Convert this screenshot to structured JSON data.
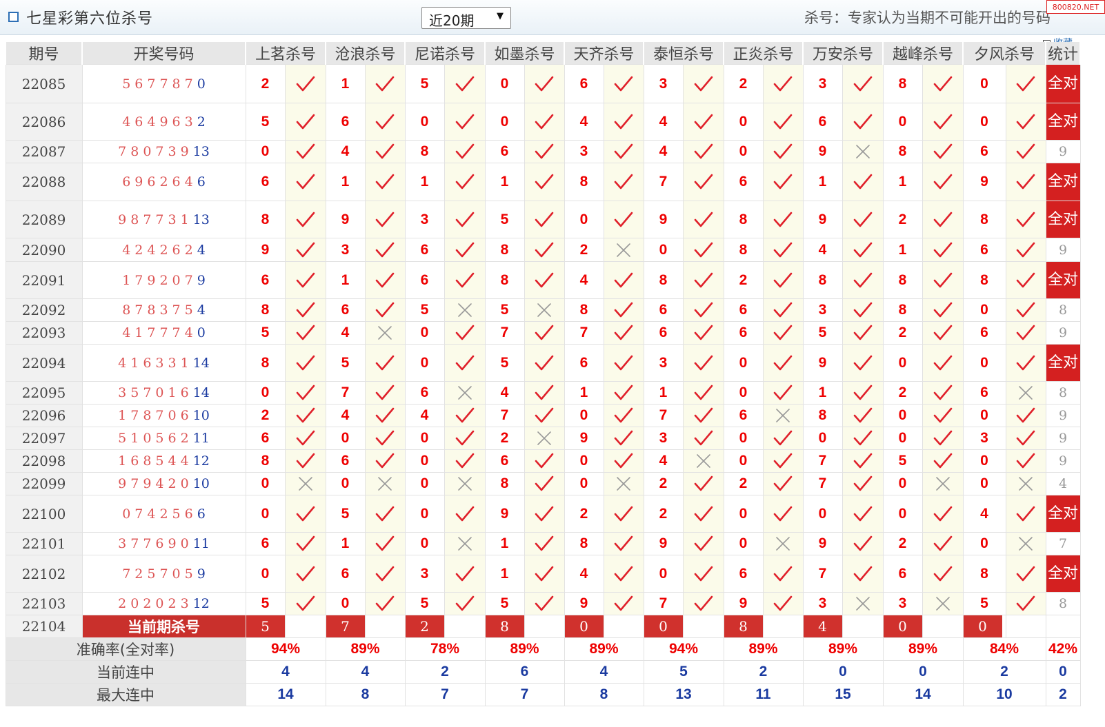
{
  "header": {
    "title": "七星彩第六位杀号",
    "period_select": "近20期",
    "hint": "杀号：专家认为当期不可能开出的号码",
    "watermark": "800820.NET",
    "collect": "收藏"
  },
  "columns": {
    "period": "期号",
    "numbers": "开奖号码",
    "experts": [
      "上茗杀号",
      "沧浪杀号",
      "尼诺杀号",
      "如墨杀号",
      "天齐杀号",
      "泰恒杀号",
      "正炎杀号",
      "万安杀号",
      "越峰杀号",
      "夕风杀号"
    ],
    "stats": "统计"
  },
  "rows": [
    {
      "period": "22085",
      "nums": "567787",
      "last": "0",
      "kills": [
        "2",
        "1",
        "5",
        "0",
        "6",
        "3",
        "2",
        "3",
        "8",
        "0"
      ],
      "hits": [
        1,
        1,
        1,
        1,
        1,
        1,
        1,
        1,
        1,
        1
      ],
      "stat": "全对"
    },
    {
      "period": "22086",
      "nums": "464963",
      "last": "2",
      "kills": [
        "5",
        "6",
        "0",
        "0",
        "4",
        "4",
        "0",
        "6",
        "0",
        "0"
      ],
      "hits": [
        1,
        1,
        1,
        1,
        1,
        1,
        1,
        1,
        1,
        1
      ],
      "stat": "全对"
    },
    {
      "period": "22087",
      "nums": "780739",
      "last": "13",
      "kills": [
        "0",
        "4",
        "8",
        "6",
        "3",
        "4",
        "0",
        "9",
        "8",
        "6"
      ],
      "hits": [
        1,
        1,
        1,
        1,
        1,
        1,
        1,
        0,
        1,
        1
      ],
      "stat": "9"
    },
    {
      "period": "22088",
      "nums": "696264",
      "last": "6",
      "kills": [
        "6",
        "1",
        "1",
        "1",
        "8",
        "7",
        "6",
        "1",
        "1",
        "9"
      ],
      "hits": [
        1,
        1,
        1,
        1,
        1,
        1,
        1,
        1,
        1,
        1
      ],
      "stat": "全对"
    },
    {
      "period": "22089",
      "nums": "987731",
      "last": "13",
      "kills": [
        "8",
        "9",
        "3",
        "5",
        "0",
        "9",
        "8",
        "9",
        "2",
        "8"
      ],
      "hits": [
        1,
        1,
        1,
        1,
        1,
        1,
        1,
        1,
        1,
        1
      ],
      "stat": "全对"
    },
    {
      "period": "22090",
      "nums": "424262",
      "last": "4",
      "kills": [
        "9",
        "3",
        "6",
        "8",
        "2",
        "0",
        "8",
        "4",
        "1",
        "6"
      ],
      "hits": [
        1,
        1,
        1,
        1,
        0,
        1,
        1,
        1,
        1,
        1
      ],
      "stat": "9"
    },
    {
      "period": "22091",
      "nums": "179207",
      "last": "9",
      "kills": [
        "6",
        "1",
        "6",
        "8",
        "4",
        "8",
        "2",
        "8",
        "8",
        "8"
      ],
      "hits": [
        1,
        1,
        1,
        1,
        1,
        1,
        1,
        1,
        1,
        1
      ],
      "stat": "全对"
    },
    {
      "period": "22092",
      "nums": "878375",
      "last": "4",
      "kills": [
        "8",
        "6",
        "5",
        "5",
        "8",
        "6",
        "6",
        "3",
        "8",
        "0"
      ],
      "hits": [
        1,
        1,
        0,
        0,
        1,
        1,
        1,
        1,
        1,
        1
      ],
      "stat": "8"
    },
    {
      "period": "22093",
      "nums": "417774",
      "last": "0",
      "kills": [
        "5",
        "4",
        "0",
        "7",
        "7",
        "6",
        "6",
        "5",
        "2",
        "6"
      ],
      "hits": [
        1,
        0,
        1,
        1,
        1,
        1,
        1,
        1,
        1,
        1
      ],
      "stat": "9"
    },
    {
      "period": "22094",
      "nums": "416331",
      "last": "14",
      "kills": [
        "8",
        "5",
        "0",
        "5",
        "6",
        "3",
        "0",
        "9",
        "0",
        "0"
      ],
      "hits": [
        1,
        1,
        1,
        1,
        1,
        1,
        1,
        1,
        1,
        1
      ],
      "stat": "全对"
    },
    {
      "period": "22095",
      "nums": "357016",
      "last": "14",
      "kills": [
        "0",
        "7",
        "6",
        "4",
        "1",
        "1",
        "0",
        "1",
        "2",
        "6"
      ],
      "hits": [
        1,
        1,
        0,
        1,
        1,
        1,
        1,
        1,
        1,
        0
      ],
      "stat": "8"
    },
    {
      "period": "22096",
      "nums": "178706",
      "last": "10",
      "kills": [
        "2",
        "4",
        "4",
        "7",
        "0",
        "7",
        "6",
        "8",
        "0",
        "0"
      ],
      "hits": [
        1,
        1,
        1,
        1,
        1,
        1,
        0,
        1,
        1,
        1
      ],
      "stat": "9"
    },
    {
      "period": "22097",
      "nums": "510562",
      "last": "11",
      "kills": [
        "6",
        "0",
        "0",
        "2",
        "9",
        "3",
        "0",
        "0",
        "0",
        "3"
      ],
      "hits": [
        1,
        1,
        1,
        0,
        1,
        1,
        1,
        1,
        1,
        1
      ],
      "stat": "9"
    },
    {
      "period": "22098",
      "nums": "168544",
      "last": "12",
      "kills": [
        "8",
        "6",
        "0",
        "6",
        "0",
        "4",
        "0",
        "7",
        "5",
        "0"
      ],
      "hits": [
        1,
        1,
        1,
        1,
        1,
        0,
        1,
        1,
        1,
        1
      ],
      "stat": "9"
    },
    {
      "period": "22099",
      "nums": "979420",
      "last": "10",
      "kills": [
        "0",
        "0",
        "0",
        "8",
        "0",
        "2",
        "2",
        "7",
        "0",
        "0"
      ],
      "hits": [
        0,
        0,
        0,
        1,
        0,
        1,
        1,
        1,
        0,
        0
      ],
      "stat": "4"
    },
    {
      "period": "22100",
      "nums": "074256",
      "last": "6",
      "kills": [
        "0",
        "5",
        "0",
        "9",
        "2",
        "2",
        "0",
        "0",
        "0",
        "4"
      ],
      "hits": [
        1,
        1,
        1,
        1,
        1,
        1,
        1,
        1,
        1,
        1
      ],
      "stat": "全对"
    },
    {
      "period": "22101",
      "nums": "377690",
      "last": "11",
      "kills": [
        "6",
        "1",
        "0",
        "1",
        "8",
        "9",
        "0",
        "9",
        "2",
        "0"
      ],
      "hits": [
        1,
        1,
        0,
        1,
        1,
        1,
        0,
        1,
        1,
        0
      ],
      "stat": "7"
    },
    {
      "period": "22102",
      "nums": "725705",
      "last": "9",
      "kills": [
        "0",
        "6",
        "3",
        "1",
        "4",
        "0",
        "6",
        "7",
        "6",
        "8"
      ],
      "hits": [
        1,
        1,
        1,
        1,
        1,
        1,
        1,
        1,
        1,
        1
      ],
      "stat": "全对"
    },
    {
      "period": "22103",
      "nums": "202023",
      "last": "12",
      "kills": [
        "5",
        "0",
        "5",
        "5",
        "9",
        "7",
        "9",
        "3",
        "3",
        "5"
      ],
      "hits": [
        1,
        1,
        1,
        1,
        1,
        1,
        1,
        0,
        0,
        1
      ],
      "stat": "8"
    }
  ],
  "current": {
    "period": "22104",
    "label": "当前期杀号",
    "kills": [
      "5",
      "7",
      "2",
      "8",
      "0",
      "0",
      "8",
      "4",
      "0",
      "0"
    ]
  },
  "stats": {
    "accuracy_label": "准确率(全对率)",
    "accuracy": [
      "94%",
      "89%",
      "78%",
      "89%",
      "89%",
      "94%",
      "89%",
      "89%",
      "89%",
      "84%",
      "42%"
    ],
    "streak_label": "当前连中",
    "streak": [
      "4",
      "4",
      "2",
      "6",
      "4",
      "5",
      "2",
      "0",
      "0",
      "2",
      "0"
    ],
    "max_label": "最大连中",
    "max": [
      "14",
      "8",
      "7",
      "7",
      "8",
      "13",
      "11",
      "15",
      "14",
      "10",
      "2"
    ]
  },
  "colors": {
    "red": "#e00000",
    "blue": "#1a3aa0",
    "check": "#e0202a",
    "cross": "#999999",
    "banner": "#d42020"
  },
  "icons": {
    "hit": "check-icon",
    "miss": "cross-icon"
  }
}
